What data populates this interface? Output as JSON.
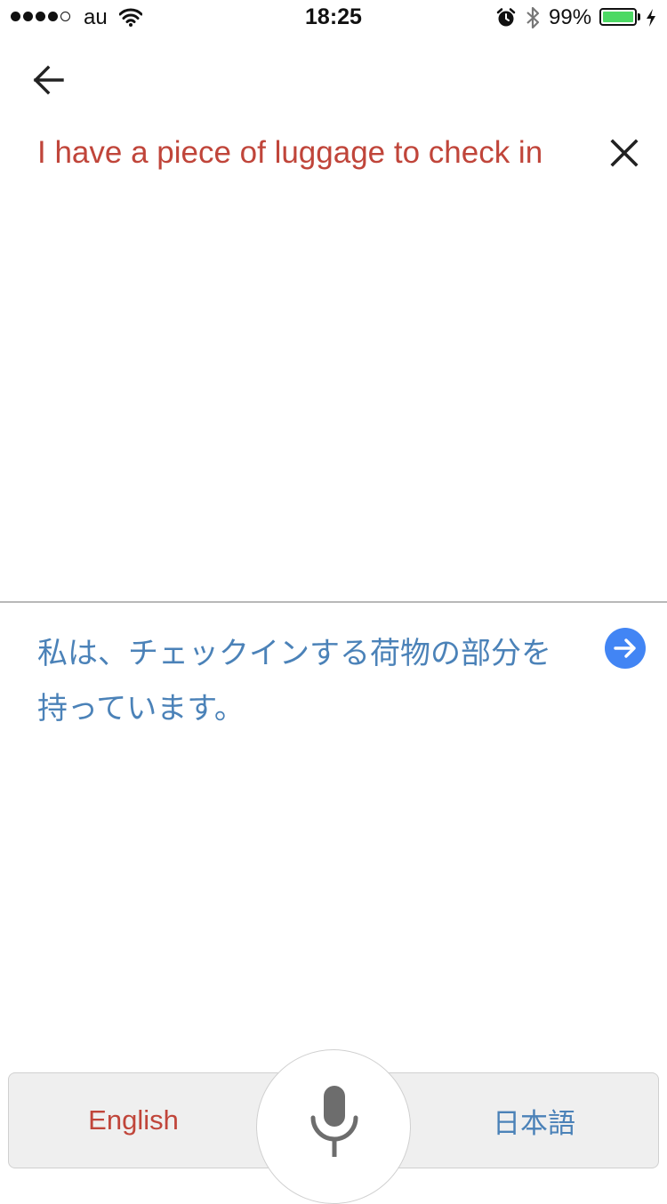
{
  "status_bar": {
    "carrier": "au",
    "time": "18:25",
    "battery_percent": "99%",
    "battery_level": 0.99,
    "battery_color": "#4cd964",
    "icons": [
      "signal-dots-icon",
      "wifi-icon",
      "alarm-icon",
      "bluetooth-icon",
      "battery-icon",
      "charging-bolt-icon"
    ]
  },
  "header": {
    "back_icon": "arrow-left-icon"
  },
  "source": {
    "text": "I have a piece of luggage to check in",
    "text_color": "#c0453a",
    "clear_icon": "close-icon"
  },
  "translation": {
    "text": "私は、チェックインする荷物の部分を持っています。",
    "text_color": "#4b82b8",
    "go_icon": "arrow-right-circle-icon",
    "go_color": "#4285f4"
  },
  "language_bar": {
    "source_language": "English",
    "target_language": "日本語",
    "mic_icon": "microphone-icon"
  }
}
